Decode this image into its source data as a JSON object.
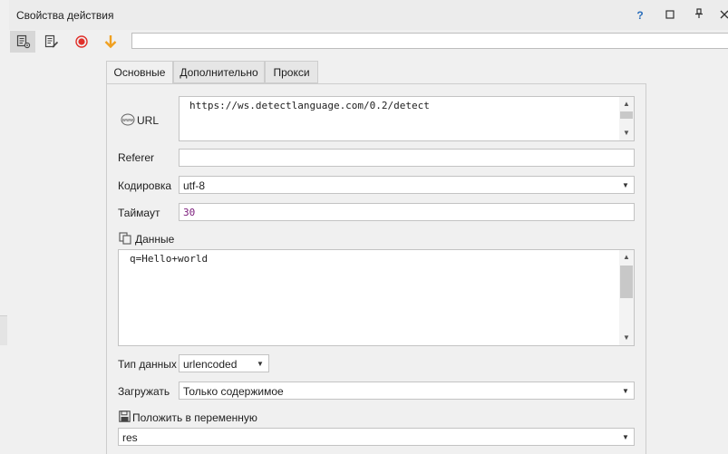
{
  "window": {
    "title": "Свойства действия",
    "buttons": [
      "?",
      "□",
      "⊥",
      "✕"
    ]
  },
  "toolbar": {
    "tools": [
      "action-settings-icon",
      "edit-notes-icon",
      "record-icon",
      "arrow-down-icon"
    ],
    "action_name_value": ""
  },
  "tabs": [
    {
      "label": "Основные",
      "active": true
    },
    {
      "label": "Дополнительно",
      "active": false
    },
    {
      "label": "Прокси",
      "active": false
    }
  ],
  "form": {
    "url_label": "URL",
    "url_value": "https://ws.detectlanguage.com/0.2/detect",
    "referer_label": "Referer",
    "referer_value": "",
    "encoding_label": "Кодировка",
    "encoding_value": "utf-8",
    "timeout_label": "Таймаут",
    "timeout_value": "30",
    "data_label": "Данные",
    "data_value": "q=Hello+world",
    "datatype_label": "Тип данных",
    "datatype_value": "urlencoded",
    "load_label": "Загружать",
    "load_value": "Только содержимое",
    "var_label": "Положить в переменную",
    "var_value": "res"
  },
  "colors": {
    "accent": "#2a6ebb",
    "record": "#e0302a",
    "arrow": "#f0a020",
    "timeout_text": "#7a1a7a"
  }
}
